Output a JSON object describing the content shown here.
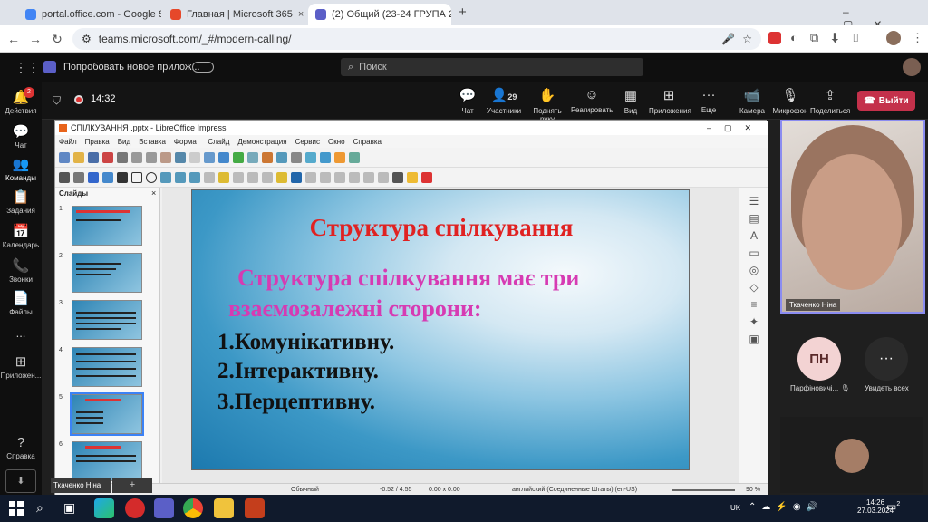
{
  "tabs": [
    {
      "label": "portal.office.com - Google Sear",
      "close": "×"
    },
    {
      "label": "Главная | Microsoft 365",
      "close": "×"
    },
    {
      "label": "(2) Общий (23-24 ГРУПА 2",
      "close": "×"
    }
  ],
  "new_tab": "+",
  "url": "teams.microsoft.com/_#/modern-calling/",
  "teams": {
    "try_new": "Попробовать новое прилож...",
    "search_placeholder": "Поиск",
    "timer": "14:32"
  },
  "rail": [
    {
      "label": "Действия",
      "badge": "2"
    },
    {
      "label": "Чат"
    },
    {
      "label": "Команды"
    },
    {
      "label": "Задания"
    },
    {
      "label": "Календарь"
    },
    {
      "label": "Звонки"
    },
    {
      "label": "Файлы"
    },
    {
      "label": "..."
    },
    {
      "label": "Приложен..."
    },
    {
      "label": "Справка"
    }
  ],
  "controls": [
    {
      "label": "Чат"
    },
    {
      "label": "Участники",
      "count": "29"
    },
    {
      "label": "Поднять руку"
    },
    {
      "label": "Реагировать"
    },
    {
      "label": "Вид"
    },
    {
      "label": "Приложения"
    },
    {
      "label": "Еще"
    },
    {
      "label": "Камера"
    },
    {
      "label": "Микрофон"
    },
    {
      "label": "Поделиться"
    }
  ],
  "leave_label": "Выйти",
  "impress": {
    "title": "СПІЛКУВАННЯ .pptx - LibreOffice Impress",
    "menu": [
      "Файл",
      "Правка",
      "Вид",
      "Вставка",
      "Формат",
      "Слайд",
      "Демонстрация",
      "Сервис",
      "Окно",
      "Справка"
    ],
    "panel_title": "Слайды",
    "slide_numbers": [
      "1",
      "2",
      "3",
      "4",
      "5",
      "6"
    ],
    "slide": {
      "title": "Структура спілкування",
      "subtitle": "Структура спілкування має  три взаємозалежні  сторони:",
      "items": [
        "1.Комунікативну.",
        "2.Інтерактивну.",
        "3.Перцептивну."
      ]
    },
    "status": {
      "layout": "Обычный",
      "pos": "-0.52 / 4.55",
      "size": "0.00 x 0.00",
      "lang": "английский (Соединенные Штаты) (en-US)",
      "zoom": "90 %"
    }
  },
  "participants": {
    "main_name": "Ткаченко Ніна",
    "pn_initials": "ПН",
    "pn_name": "Парфіновичі...",
    "see_all": "Увидеть всех",
    "drag_name": "Ткаченко Ніна"
  },
  "taskbar": {
    "lang": "UK",
    "time": "14:26",
    "date": "27.03.2024",
    "notif": "2"
  },
  "colors": {
    "teams_accent": "#8b8cf0",
    "leave": "#c4314b",
    "slide_title": "#e02222",
    "slide_subtitle": "#d63bb3"
  }
}
